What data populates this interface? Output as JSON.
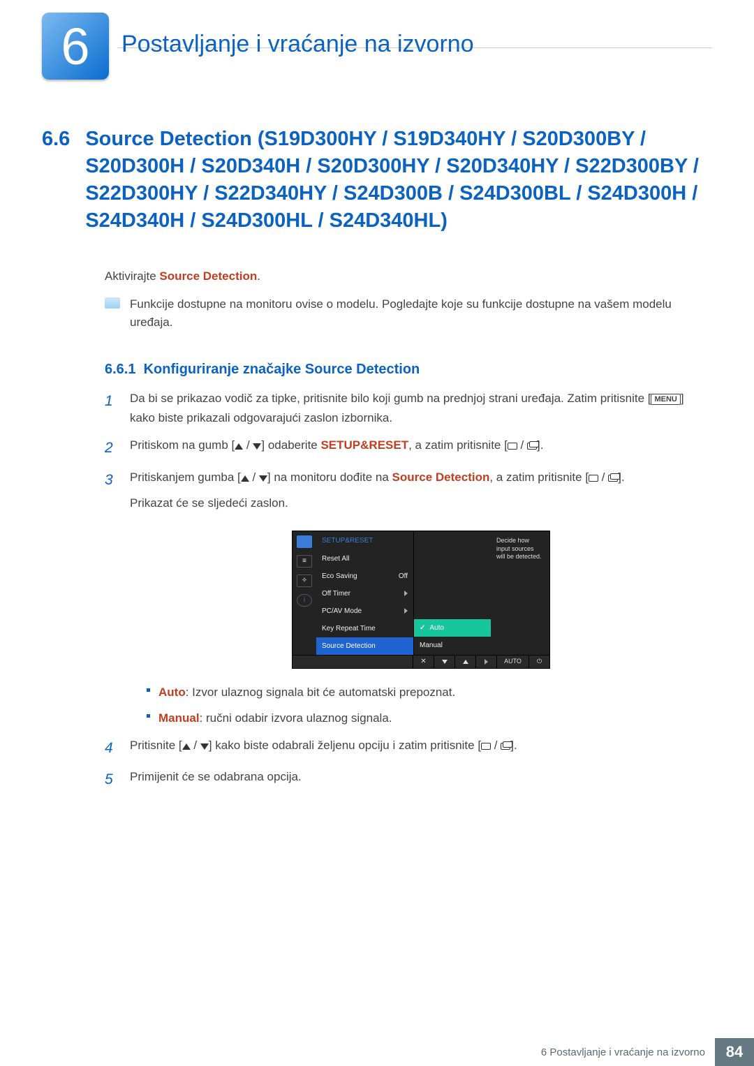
{
  "chapter": {
    "number": "6",
    "title": "Postavljanje i vraćanje na izvorno"
  },
  "section": {
    "number": "6.6",
    "title": "Source Detection (S19D300HY / S19D340HY / S20D300BY / S20D300H / S20D340H / S20D300HY / S20D340HY / S22D300BY / S22D300HY / S22D340HY / S24D300B / S24D300BL / S24D300H / S24D340H / S24D300HL / S24D340HL)"
  },
  "intro": {
    "prefix": "Aktivirajte ",
    "keyword": "Source Detection",
    "suffix": "."
  },
  "note": "Funkcije dostupne na monitoru ovise o modelu. Pogledajte koje su funkcije dostupne na vašem modelu uređaja.",
  "subsection": {
    "number": "6.6.1",
    "title": "Konfiguriranje značajke Source Detection"
  },
  "menu_key": "MENU",
  "steps": {
    "s1a": "Da bi se prikazao vodič za tipke, pritisnite bilo koji gumb na prednjoj strani uređaja. Zatim pritisnite [",
    "s1b": "] kako biste prikazali odgovarajući zaslon izbornika.",
    "s2a": "Pritiskom na gumb [",
    "s2b": "] odaberite ",
    "s2_kw": "SETUP&RESET",
    "s2c": ", a zatim pritisnite [",
    "s2d": "].",
    "s3a": "Pritiskanjem gumba [",
    "s3b": "] na monitoru dođite na ",
    "s3_kw": "Source Detection",
    "s3c": ", a zatim pritisnite [",
    "s3d": "].",
    "s3_tail": "Prikazat će se sljedeći zaslon.",
    "s4a": "Pritisnite [",
    "s4b": "] kako biste odabrali željenu opciju i zatim pritisnite [",
    "s4c": "].",
    "s5": "Primijenit će se odabrana opcija."
  },
  "bullets": {
    "auto_label": "Auto",
    "auto_txt": ": Izvor ulaznog signala bit će automatski prepoznat.",
    "manual_label": "Manual",
    "manual_txt": ": ručni odabir izvora ulaznog signala."
  },
  "osd": {
    "title": "SETUP&RESET",
    "items": [
      "Reset All",
      "Eco Saving",
      "Off Timer",
      "PC/AV Mode",
      "Key Repeat Time",
      "Source Detection"
    ],
    "values": [
      "",
      "Off",
      "",
      "",
      "",
      ""
    ],
    "options": [
      "Auto",
      "Manual"
    ],
    "hint": "Decide how input sources will be detected.",
    "footer_auto": "AUTO"
  },
  "footer": {
    "label": "6 Postavljanje i vraćanje na izvorno",
    "page": "84"
  }
}
